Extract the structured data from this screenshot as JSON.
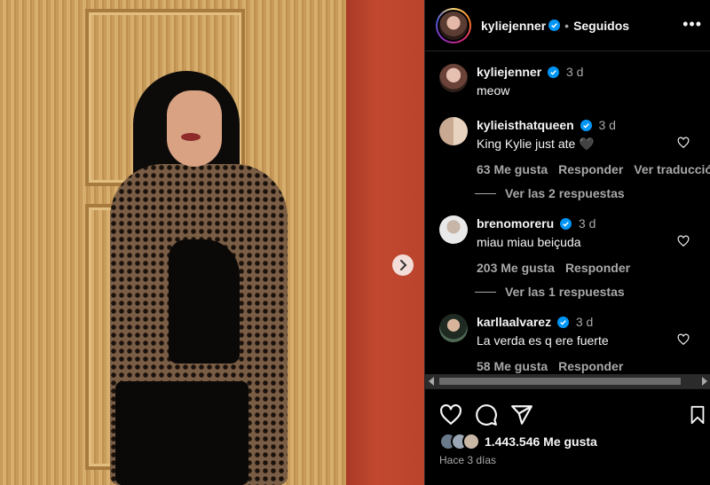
{
  "post": {
    "username": "kyliejenner",
    "follow_label": "Seguidos",
    "more_label": "•••",
    "likes": "1.443.546 Me gusta",
    "posted": "Hace 3 días"
  },
  "comments": [
    {
      "username": "kyliejenner",
      "time": "3 d",
      "text": "meow"
    },
    {
      "username": "kylieisthatqueen",
      "time": "3 d",
      "text": "King Kylie just ate 🖤",
      "likes": "63 Me gusta",
      "reply": "Responder",
      "translate": "Ver traducción"
    },
    {
      "username": "brenomoreru",
      "time": "3 d",
      "text": "miau miau beiçuda",
      "likes": "203 Me gusta",
      "reply": "Responder"
    },
    {
      "username": "karllaalvarez",
      "time": "3 d",
      "text": "La verda es q ere fuerte",
      "likes": "58 Me gusta",
      "reply": "Responder"
    }
  ],
  "view_replies": [
    "Ver las 2 respuestas",
    "Ver las 1 respuestas"
  ],
  "colors": {
    "verified": "#0095f6",
    "text": "#f5f5f5",
    "secondary": "#a8a8a8",
    "background": "#000000"
  }
}
